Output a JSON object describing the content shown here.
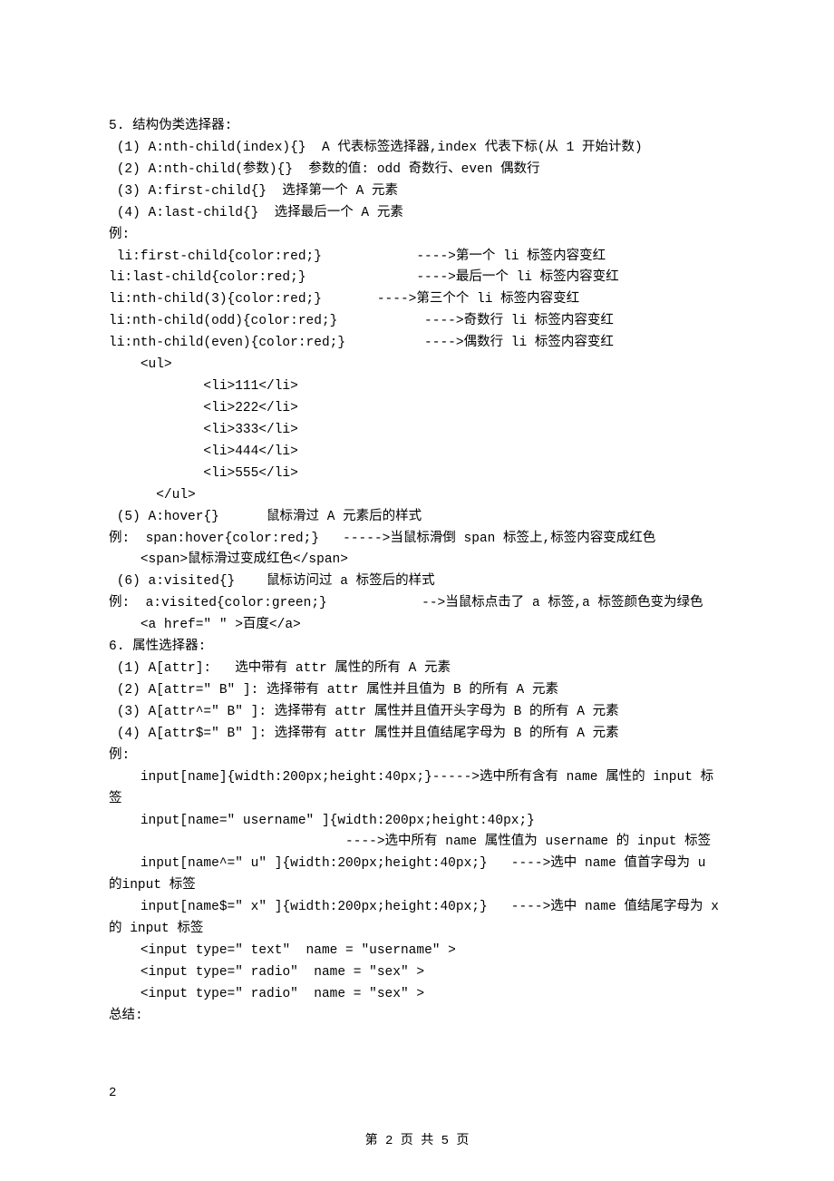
{
  "lines": [
    "5. 结构伪类选择器:",
    " (1) A:nth-child(index){}  A 代表标签选择器,index 代表下标(从 1 开始计数)",
    " (2) A:nth-child(参数){}  参数的值: odd 奇数行、even 偶数行",
    " (3) A:first-child{}  选择第一个 A 元素",
    " (4) A:last-child{}  选择最后一个 A 元素",
    "例:",
    " li:first-child{color:red;}            ---->第一个 li 标签内容变红",
    "li:last-child{color:red;}              ---->最后一个 li 标签内容变红",
    "li:nth-child(3){color:red;}       ---->第三个个 li 标签内容变红",
    "li:nth-child(odd){color:red;}           ---->奇数行 li 标签内容变红",
    "li:nth-child(even){color:red;}          ---->偶数行 li 标签内容变红",
    "    <ul>",
    "            <li>111</li>",
    "            <li>222</li>",
    "            <li>333</li>",
    "            <li>444</li>",
    "            <li>555</li>",
    "      </ul>",
    " (5) A:hover{}      鼠标滑过 A 元素后的样式",
    "例:  span:hover{color:red;}   ----->当鼠标滑倒 span 标签上,标签内容变成红色",
    "    <span>鼠标滑过变成红色</span>",
    " (6) a:visited{}    鼠标访问过 a 标签后的样式",
    "例:  a:visited{color:green;}            -->当鼠标点击了 a 标签,a 标签颜色变为绿色",
    "    <a href=\" \" >百度</a>",
    "6. 属性选择器:",
    " (1) A[attr]:   选中带有 attr 属性的所有 A 元素",
    " (2) A[attr=\" B\" ]: 选择带有 attr 属性并且值为 B 的所有 A 元素",
    " (3) A[attr^=\" B\" ]: 选择带有 attr 属性并且值开头字母为 B 的所有 A 元素",
    " (4) A[attr$=\" B\" ]: 选择带有 attr 属性并且值结尾字母为 B 的所有 A 元素",
    "例:",
    "    input[name]{width:200px;height:40px;}----->选中所有含有 name 属性的 input 标签",
    "    input[name=\" username\" ]{width:200px;height:40px;}",
    "                              ---->选中所有 name 属性值为 username 的 input 标签",
    "    input[name^=\" u\" ]{width:200px;height:40px;}   ---->选中 name 值首字母为 u 的input 标签",
    "    input[name$=\" x\" ]{width:200px;height:40px;}   ---->选中 name 值结尾字母为 x的 input 标签",
    "    <input type=\" text\"  name = \"username\" >",
    "    <input type=\" radio\"  name = \"sex\" >",
    "    <input type=\" radio\"  name = \"sex\" >",
    "总结:"
  ],
  "footer_left": "2",
  "footer_center": "第 2 页 共 5 页"
}
